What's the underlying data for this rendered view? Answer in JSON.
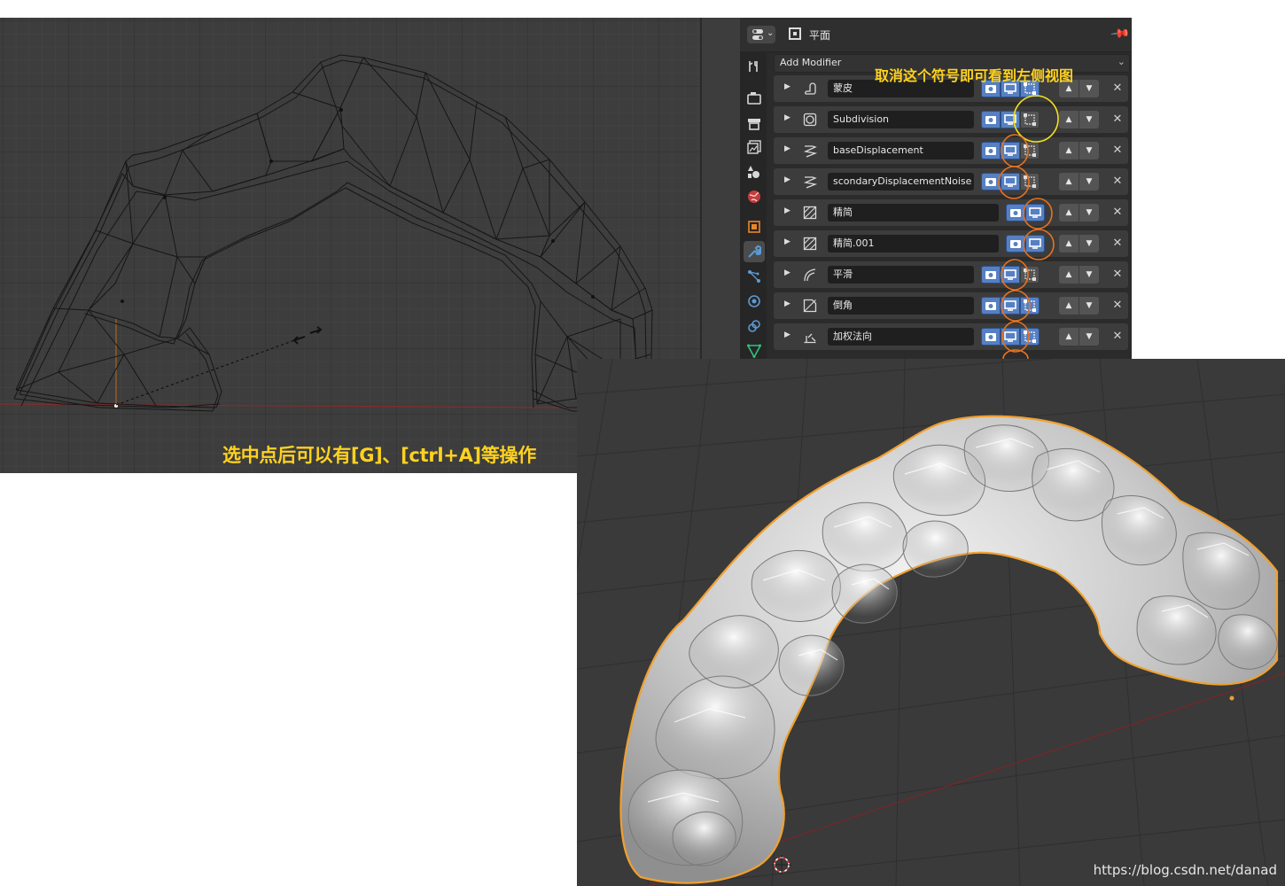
{
  "wire_viewport": {
    "caption": "选中点后可以有[G]、[ctrl+A]等操作"
  },
  "properties": {
    "object_name": "平面",
    "add_modifier_label": "Add Modifier",
    "annotation": "取消这个符号即可看到左侧视图",
    "modifiers": [
      {
        "name": "蒙皮",
        "icon": "skin-icon"
      },
      {
        "name": "Subdivision",
        "icon": "subdivision-icon"
      },
      {
        "name": "baseDisplacement",
        "icon": "displace-icon"
      },
      {
        "name": "scondaryDisplacementNoise",
        "icon": "displace-icon"
      },
      {
        "name": "精简",
        "icon": "decimate-icon"
      },
      {
        "name": "精简.001",
        "icon": "decimate-icon"
      },
      {
        "name": "平滑",
        "icon": "smooth-icon"
      },
      {
        "name": "倒角",
        "icon": "bevel-icon"
      },
      {
        "name": "加权法向",
        "icon": "weighted-normal-icon"
      }
    ],
    "tabs": [
      "tool-tab",
      "render-tab",
      "output-tab",
      "view-layer-tab",
      "scene-tab",
      "world-tab",
      "object-tab",
      "modifier-tab",
      "particles-tab",
      "physics-tab",
      "constraints-tab",
      "data-tab"
    ],
    "active_tab": "modifier-tab"
  },
  "solid_viewport": {
    "watermark": "https://blog.csdn.net/danad"
  },
  "colors": {
    "accent_blue": "#5680c2",
    "annotation_yellow": "#ffd21f",
    "annotation_orange": "#e8721f",
    "selection_outline": "#f0a030"
  }
}
